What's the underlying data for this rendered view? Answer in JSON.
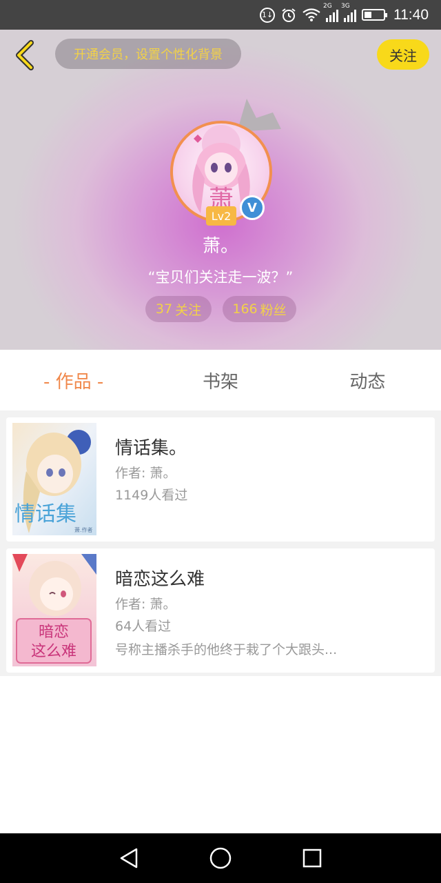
{
  "status_bar": {
    "time": "11:40",
    "network_1": "2G",
    "network_2": "3G"
  },
  "header": {
    "vip_prompt": "开通会员，设置个性化背景",
    "follow_button": "关注",
    "level": "Lv2",
    "verified_mark": "V",
    "username": "萧。",
    "signature": "“宝贝们关注走一波？”",
    "following": {
      "count": "37",
      "label": "关注"
    },
    "followers": {
      "count": "166",
      "label": "粉丝"
    },
    "avatar_char": "萧"
  },
  "tabs": [
    {
      "label": "- 作品 -",
      "active": true
    },
    {
      "label": "书架",
      "active": false
    },
    {
      "label": "动态",
      "active": false
    }
  ],
  "books": [
    {
      "title": "情话集。",
      "author": "作者: 萧。",
      "views": "1149人看过",
      "description": "",
      "cover_text": "情话集",
      "cover_small": "萧.作者"
    },
    {
      "title": "暗恋这么难",
      "author": "作者: 萧。",
      "views": "64人看过",
      "description": "号称主播杀手的他终于栽了个大跟头...",
      "cover_text_1": "暗恋",
      "cover_text_2": "这么难"
    }
  ],
  "colors": {
    "accent": "#f0884b",
    "follow_yellow": "#f8d91a",
    "stat_yellow": "#f3d247",
    "header_pink": "#cf6fcf"
  }
}
